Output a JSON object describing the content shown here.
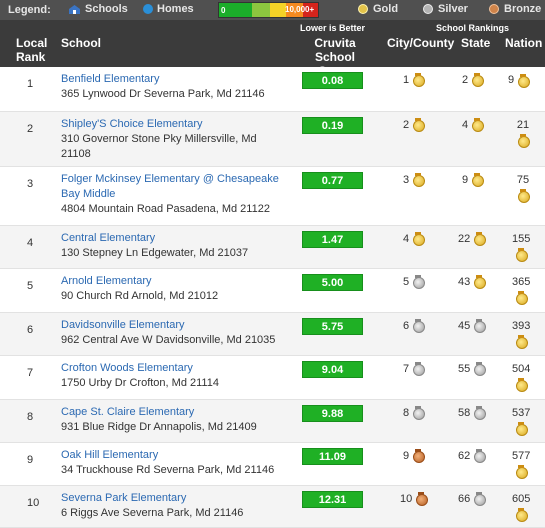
{
  "legend": {
    "title": "Legend:",
    "schools": "Schools",
    "homes": "Homes",
    "scale_min": "0",
    "scale_max": "10,000+",
    "gold": "Gold",
    "silver": "Silver",
    "bronze": "Bronze"
  },
  "header": {
    "local_rank": "Local Rank",
    "school": "School",
    "lower_note": "Lower is Better",
    "score": "Cruvita School Score",
    "rankings": "School Rankings",
    "city_county": "City/County",
    "state": "State",
    "nation": "Nation"
  },
  "colors": {
    "score_green": "#1fb025",
    "link": "#2b69b2",
    "header_bg": "#3b3b3b",
    "legend_bg": "#505050"
  },
  "rows": [
    {
      "rank": "1",
      "name": "Benfield Elementary",
      "address": "365 Lynwood Dr Severna Park, Md 21146",
      "score": "0.08",
      "city": "1",
      "city_medal": "gold",
      "state": "2",
      "state_medal": "gold",
      "nation": "9",
      "nation_medal": "gold"
    },
    {
      "rank": "2",
      "name": "Shipley'S Choice Elementary",
      "address": "310 Governor Stone Pky Millersville, Md 21108",
      "score": "0.19",
      "city": "2",
      "city_medal": "gold",
      "state": "4",
      "state_medal": "gold",
      "nation": "21",
      "nation_medal": "gold"
    },
    {
      "rank": "3",
      "name": "Folger Mckinsey Elementary @ Chesapeake Bay Middle",
      "address": "4804 Mountain Road Pasadena, Md 21122",
      "score": "0.77",
      "city": "3",
      "city_medal": "gold",
      "state": "9",
      "state_medal": "gold",
      "nation": "75",
      "nation_medal": "gold"
    },
    {
      "rank": "4",
      "name": "Central Elementary",
      "address": "130 Stepney Ln Edgewater, Md 21037",
      "score": "1.47",
      "city": "4",
      "city_medal": "gold",
      "state": "22",
      "state_medal": "gold",
      "nation": "155",
      "nation_medal": "gold"
    },
    {
      "rank": "5",
      "name": "Arnold Elementary",
      "address": "90 Church Rd Arnold, Md 21012",
      "score": "5.00",
      "city": "5",
      "city_medal": "silver",
      "state": "43",
      "state_medal": "gold",
      "nation": "365",
      "nation_medal": "gold"
    },
    {
      "rank": "6",
      "name": "Davidsonville Elementary",
      "address": "962 Central Ave W Davidsonville, Md 21035",
      "score": "5.75",
      "city": "6",
      "city_medal": "silver",
      "state": "45",
      "state_medal": "silver",
      "nation": "393",
      "nation_medal": "gold"
    },
    {
      "rank": "7",
      "name": "Crofton Woods Elementary",
      "address": "1750 Urby Dr Crofton, Md 21114",
      "score": "9.04",
      "city": "7",
      "city_medal": "silver",
      "state": "55",
      "state_medal": "silver",
      "nation": "504",
      "nation_medal": "gold"
    },
    {
      "rank": "8",
      "name": "Cape St. Claire Elementary",
      "address": "931 Blue Ridge Dr Annapolis, Md 21409",
      "score": "9.88",
      "city": "8",
      "city_medal": "silver",
      "state": "58",
      "state_medal": "silver",
      "nation": "537",
      "nation_medal": "gold"
    },
    {
      "rank": "9",
      "name": "Oak Hill Elementary",
      "address": "34 Truckhouse Rd Severna Park, Md 21146",
      "score": "11.09",
      "city": "9",
      "city_medal": "bronze",
      "state": "62",
      "state_medal": "silver",
      "nation": "577",
      "nation_medal": "gold"
    },
    {
      "rank": "10",
      "name": "Severna Park Elementary",
      "address": "6 Riggs Ave Severna Park, Md 21146",
      "score": "12.31",
      "city": "10",
      "city_medal": "bronze",
      "state": "66",
      "state_medal": "silver",
      "nation": "605",
      "nation_medal": "gold"
    }
  ]
}
